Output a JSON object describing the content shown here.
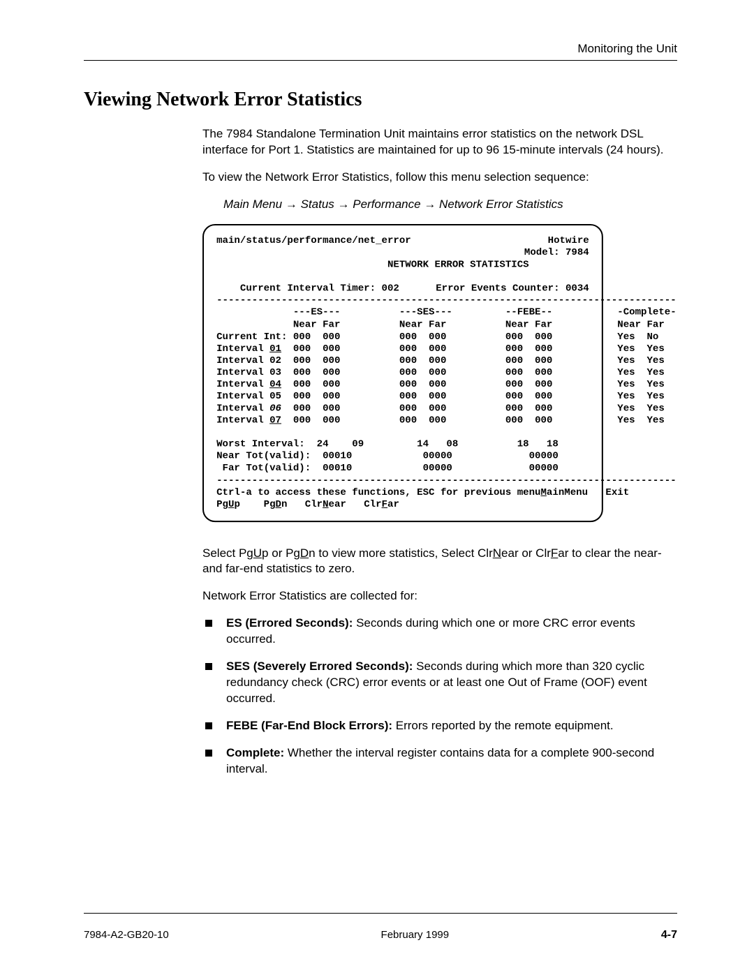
{
  "header": {
    "section": "Monitoring the Unit"
  },
  "title": "Viewing Network Error Statistics",
  "intro": "The 7984 Standalone Termination Unit maintains error statistics on the network DSL interface for Port 1. Statistics are maintained for up to 96 15-minute intervals (24 hours).",
  "intro2": "To view the Network Error Statistics, follow this menu selection sequence:",
  "menu_path": {
    "a": "Main Menu",
    "b": "Status",
    "c": "Performance",
    "d": "Network Error Statistics"
  },
  "terminal": {
    "pathline": "main/status/performance/net_error",
    "brand": "Hotwire",
    "model": "Model: 7984",
    "title": "NETWORK ERROR STATISTICS",
    "cit_label": "Current Interval Timer:",
    "cit_value": "002",
    "eec_label": "Error Events Counter:",
    "eec_value": "0034",
    "rule": "------------------------------------------------------------------------------",
    "col_es": "---ES---",
    "col_ses": "---SES---",
    "col_febe": "--FEBE--",
    "col_comp": "-Complete-",
    "sub_nf": "Near Far",
    "rows": [
      {
        "label": "Current Int:",
        "u": "",
        "es_n": "000",
        "es_f": "000",
        "ses_n": "000",
        "ses_f": "000",
        "febe_n": "000",
        "febe_f": "000",
        "cn": "Yes",
        "cf": "No"
      },
      {
        "label": "Interval ",
        "u": "01",
        "es_n": "000",
        "es_f": "000",
        "ses_n": "000",
        "ses_f": "000",
        "febe_n": "000",
        "febe_f": "000",
        "cn": "Yes",
        "cf": "Yes"
      },
      {
        "label": "Interval 02",
        "u": "",
        "es_n": "000",
        "es_f": "000",
        "ses_n": "000",
        "ses_f": "000",
        "febe_n": "000",
        "febe_f": "000",
        "cn": "Yes",
        "cf": "Yes"
      },
      {
        "label": "Interval 03",
        "u": "",
        "es_n": "000",
        "es_f": "000",
        "ses_n": "000",
        "ses_f": "000",
        "febe_n": "000",
        "febe_f": "000",
        "cn": "Yes",
        "cf": "Yes"
      },
      {
        "label": "Interval ",
        "u": "04",
        "es_n": "000",
        "es_f": "000",
        "ses_n": "000",
        "ses_f": "000",
        "febe_n": "000",
        "febe_f": "000",
        "cn": "Yes",
        "cf": "Yes"
      },
      {
        "label": "Interval 05",
        "u": "",
        "es_n": "000",
        "es_f": "000",
        "ses_n": "000",
        "ses_f": "000",
        "febe_n": "000",
        "febe_f": "000",
        "cn": "Yes",
        "cf": "Yes"
      },
      {
        "label": "Interval_06",
        "u": "",
        "es_n": "000",
        "es_f": "000",
        "ses_n": "000",
        "ses_f": "000",
        "febe_n": "000",
        "febe_f": "000",
        "cn": "Yes",
        "cf": "Yes",
        "italic_lbl": true
      },
      {
        "label": "Interval ",
        "u": "07",
        "es_n": "000",
        "es_f": "000",
        "ses_n": "000",
        "ses_f": "000",
        "febe_n": "000",
        "febe_f": "000",
        "cn": "Yes",
        "cf": "Yes"
      }
    ],
    "worst": {
      "label": "Worst Interval:",
      "es_n": "24",
      "es_f": "09",
      "ses_n": "14",
      "ses_f": "08",
      "febe_n": "18",
      "febe_f": "18"
    },
    "near_tot": {
      "label": "Near Tot(valid):",
      "es": "00010",
      "ses": "00000",
      "febe": "00000"
    },
    "far_tot": {
      "label": " Far Tot(valid):",
      "es": "00010",
      "ses": "00000",
      "febe": "00000"
    },
    "help1a": "Ctrl-a to access these functions, ESC for previous menu",
    "help1b_main": "M",
    "help1b_rest": "ainMenu   Exit",
    "help2": "PgUp    PgDn   ClrNear   ClrFar",
    "h2_pgu": "U",
    "h2_pgd": "D",
    "h2_cn": "N",
    "h2_cf": "F"
  },
  "post1a": "Select Pg",
  "post1b": " or Pg",
  "post1c": " to view more statistics, Select Clr",
  "post1d": "ear or Clr",
  "post1e": "ar to clear the near- and far-end statistics to zero.",
  "post_U": "U",
  "post_D": "D",
  "post_N": "N",
  "post_F": "F",
  "post2": "Network Error Statistics are collected for:",
  "defs": [
    {
      "term": "ES (Errored Seconds):",
      "desc": " Seconds during which one or more CRC error events occurred."
    },
    {
      "term": "SES (Severely Errored Seconds):",
      "desc": " Seconds during which more than 320 cyclic redundancy check (CRC) error events or at least one Out of Frame (OOF) event occurred."
    },
    {
      "term": "FEBE (Far-End Block Errors):",
      "desc": " Errors reported by the remote equipment."
    },
    {
      "term": "Complete:",
      "desc": " Whether the interval register contains data for a complete 900-second interval."
    }
  ],
  "footer": {
    "left": "7984-A2-GB20-10",
    "center": "February 1999",
    "right": "4-7"
  }
}
